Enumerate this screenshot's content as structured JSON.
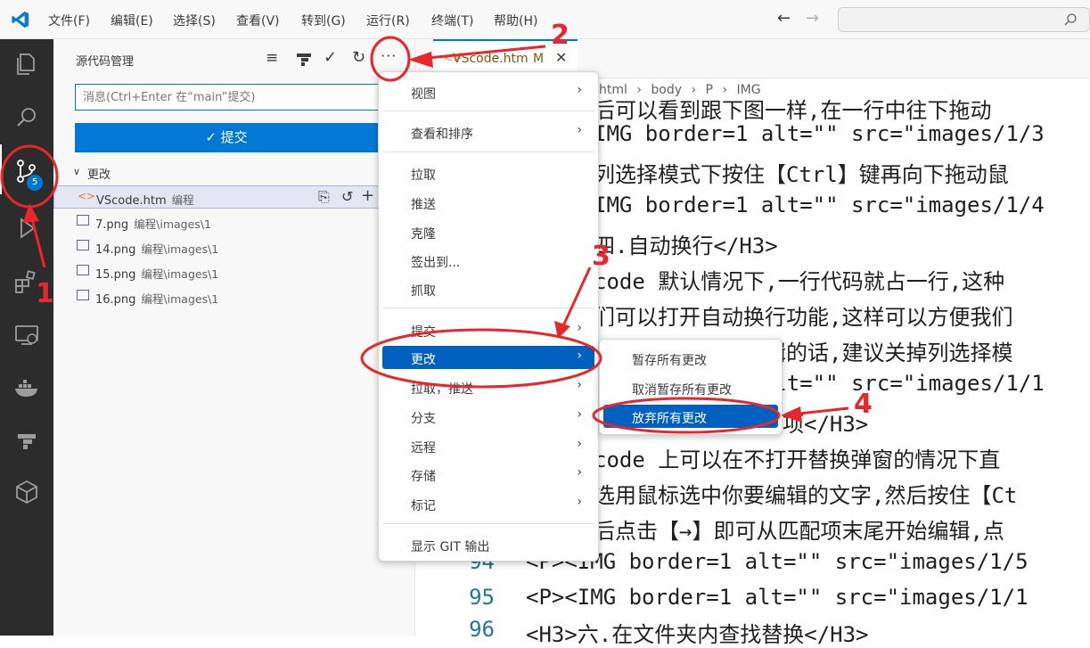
{
  "menubar": {
    "items": [
      "文件(F)",
      "编辑(E)",
      "选择(S)",
      "查看(V)",
      "转到(G)",
      "运行(R)",
      "终端(T)",
      "帮助(H)"
    ]
  },
  "activity_bar": {
    "scm_badge": "5",
    "icons": [
      "explorer-icon",
      "search-icon",
      "source-control-icon",
      "run-debug-icon",
      "extensions-icon",
      "remote-explorer-icon",
      "docker-icon",
      "git-graph-icon",
      "cube-icon"
    ]
  },
  "sidebar": {
    "title": "源代码管理",
    "message_placeholder": "消息(Ctrl+Enter 在“main”提交)",
    "commit_label": "✓ 提交",
    "changes_header": "更改",
    "files": [
      {
        "name": "VScode.htm",
        "path": "编程"
      },
      {
        "name": "7.png",
        "path": "编程\\images\\1"
      },
      {
        "name": "14.png",
        "path": "编程\\images\\1"
      },
      {
        "name": "15.png",
        "path": "编程\\images\\1"
      },
      {
        "name": "16.png",
        "path": "编程\\images\\1"
      }
    ]
  },
  "editor": {
    "tab_label": "VScode.htm",
    "tab_status": "M",
    "breadcrumb": [
      "html",
      "body",
      "P",
      "IMG"
    ],
    "line_numbers": [
      "94",
      "95",
      "96"
    ],
    "code_lines": [
      "后可以看到跟下图一样,在一行中往下拖动",
      "IMG border=1 alt=\"\" src=\"images/1/3",
      "列选择模式下按住【Ctrl】键再向下拖动鼠",
      "IMG border=1 alt=\"\" src=\"images/1/4",
      "四.自动换行</H3>",
      "code 默认情况下,一行代码就占一行,这种",
      "们可以打开自动换行功能,这样可以方便我们",
      "自动换行形式下编辑的话,建议关掉列选择模",
      "IMG border=1 alt=\"\" src=\"images/1/1",
      "项</H3>",
      "code 上可以在不打开替换弹窗的情况下直",
      "选用鼠标选中你要编辑的文字,然后按住【Ct",
      "后点击【→】即可从匹配项末尾开始编辑,点",
      "<P><IMG border=1 alt=\"\" src=\"images/1/5",
      "<P><IMG border=1 alt=\"\" src=\"images/1/1",
      "<H3>六.在文件夹内查找替换</H3>"
    ]
  },
  "context_menu": {
    "items": [
      "视图",
      "查看和排序",
      "拉取",
      "推送",
      "克隆",
      "签出到...",
      "抓取",
      "提交",
      "更改",
      "拉取，推送",
      "分支",
      "远程",
      "存储",
      "标记",
      "显示 GIT 输出"
    ]
  },
  "submenu": {
    "items": [
      "暂存所有更改",
      "取消暂存所有更改",
      "放弃所有更改"
    ]
  },
  "annotations": [
    "1",
    "2",
    "3",
    "4"
  ],
  "colors": {
    "accent": "#0060c0",
    "annotation": "#e8262b",
    "activity_bar": "#2c2c2c"
  }
}
